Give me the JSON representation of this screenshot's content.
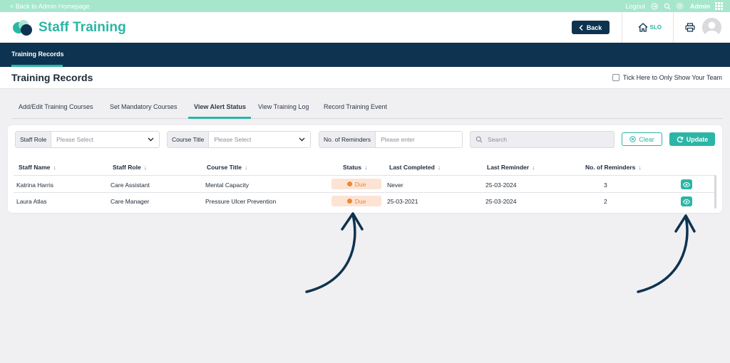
{
  "topbar": {
    "back_link": "< Back to Admin Homepage",
    "logout": "Logout",
    "admin": "Admin"
  },
  "header": {
    "app_title": "Staff Training",
    "back_button": "Back",
    "home_label": "SLO"
  },
  "nav": {
    "active_item": "Training Records"
  },
  "page": {
    "title": "Training Records",
    "team_checkbox_label": "Tick Here to Only Show Your Team"
  },
  "tabs": [
    {
      "label": "Add/Edit Training Courses"
    },
    {
      "label": "Set Mandatory Courses"
    },
    {
      "label": "View Alert Status",
      "active": true
    },
    {
      "label": "View Training Log"
    },
    {
      "label": "Record Training Event"
    }
  ],
  "filters": {
    "staff_role": {
      "label": "Staff Role",
      "placeholder": "Please Select"
    },
    "course_title": {
      "label": "Course Title",
      "placeholder": "Please Select"
    },
    "reminders": {
      "label": "No. of Reminders",
      "placeholder": "Please enter"
    },
    "search_placeholder": "Search",
    "clear_button": "Clear",
    "update_button": "Update"
  },
  "table": {
    "columns": [
      "Staff Name",
      "Staff Role",
      "Course Title",
      "Status",
      "Last Completed",
      "Last Reminder",
      "No. of Reminders"
    ],
    "rows": [
      {
        "staff_name": "Katrina Harris",
        "staff_role": "Care Assistant",
        "course_title": "Mental Capacity",
        "status": "Due",
        "last_completed": "Never",
        "last_reminder": "25-03-2024",
        "reminders": "3"
      },
      {
        "staff_name": "Laura Atlas",
        "staff_role": "Care Manager",
        "course_title": "Pressure Ulcer Prevention",
        "status": "Due",
        "last_completed": "25-03-2021",
        "last_reminder": "25-03-2024",
        "reminders": "2"
      }
    ]
  },
  "colors": {
    "brand_teal": "#2bb5a6",
    "navy": "#0e3350",
    "mint_bar": "#a6e6cd",
    "due_badge_bg": "#fde3d4",
    "due_badge_text": "#e88a34"
  }
}
